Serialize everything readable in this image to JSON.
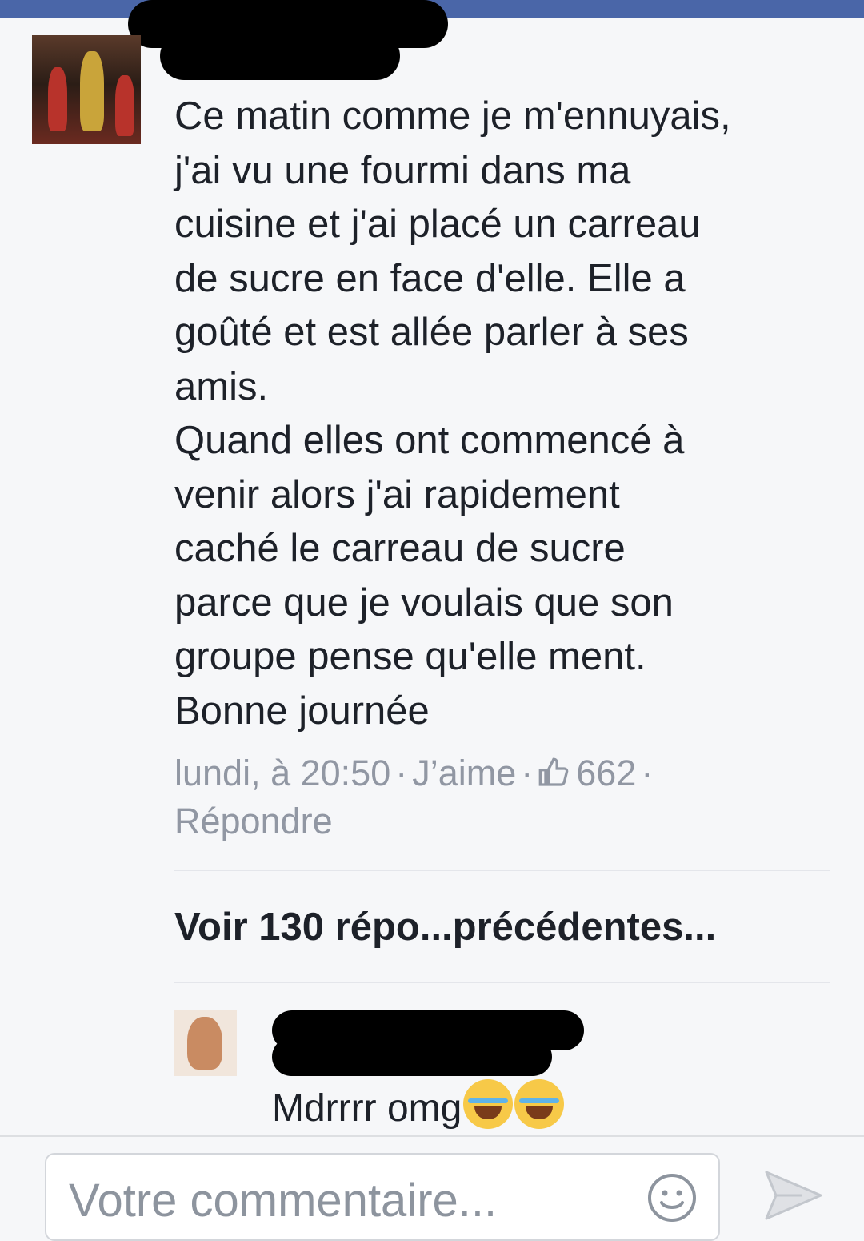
{
  "post": {
    "text": "Ce matin comme je m'ennuyais,\nj'ai vu une fourmi dans ma\ncuisine et j'ai placé un carreau\nde sucre en face d'elle. Elle a\ngoûté et est allée parler à ses\namis.\nQuand elles ont commencé à\nvenir alors j'ai rapidement\ncaché le carreau de sucre\nparce que je voulais que son\ngroupe pense qu'elle ment.\nBonne journée",
    "timestamp": "lundi, à 20:50",
    "like_label": "J’aime",
    "like_count": "662",
    "reply_label": "Répondre",
    "separator": "·"
  },
  "see_more": "Voir 130 répo...précédentes...",
  "reply": {
    "text": "Mdrrrr omg"
  },
  "composer": {
    "placeholder": "Votre commentaire..."
  },
  "icons": {
    "like": "thumbs-up-icon",
    "emoji": "smiley-icon",
    "send": "send-icon",
    "laugh": "laughing-crying-emoji-icon"
  },
  "colors": {
    "top_bar": "#4a66a8",
    "text": "#1d2129",
    "meta": "#9197a3"
  }
}
